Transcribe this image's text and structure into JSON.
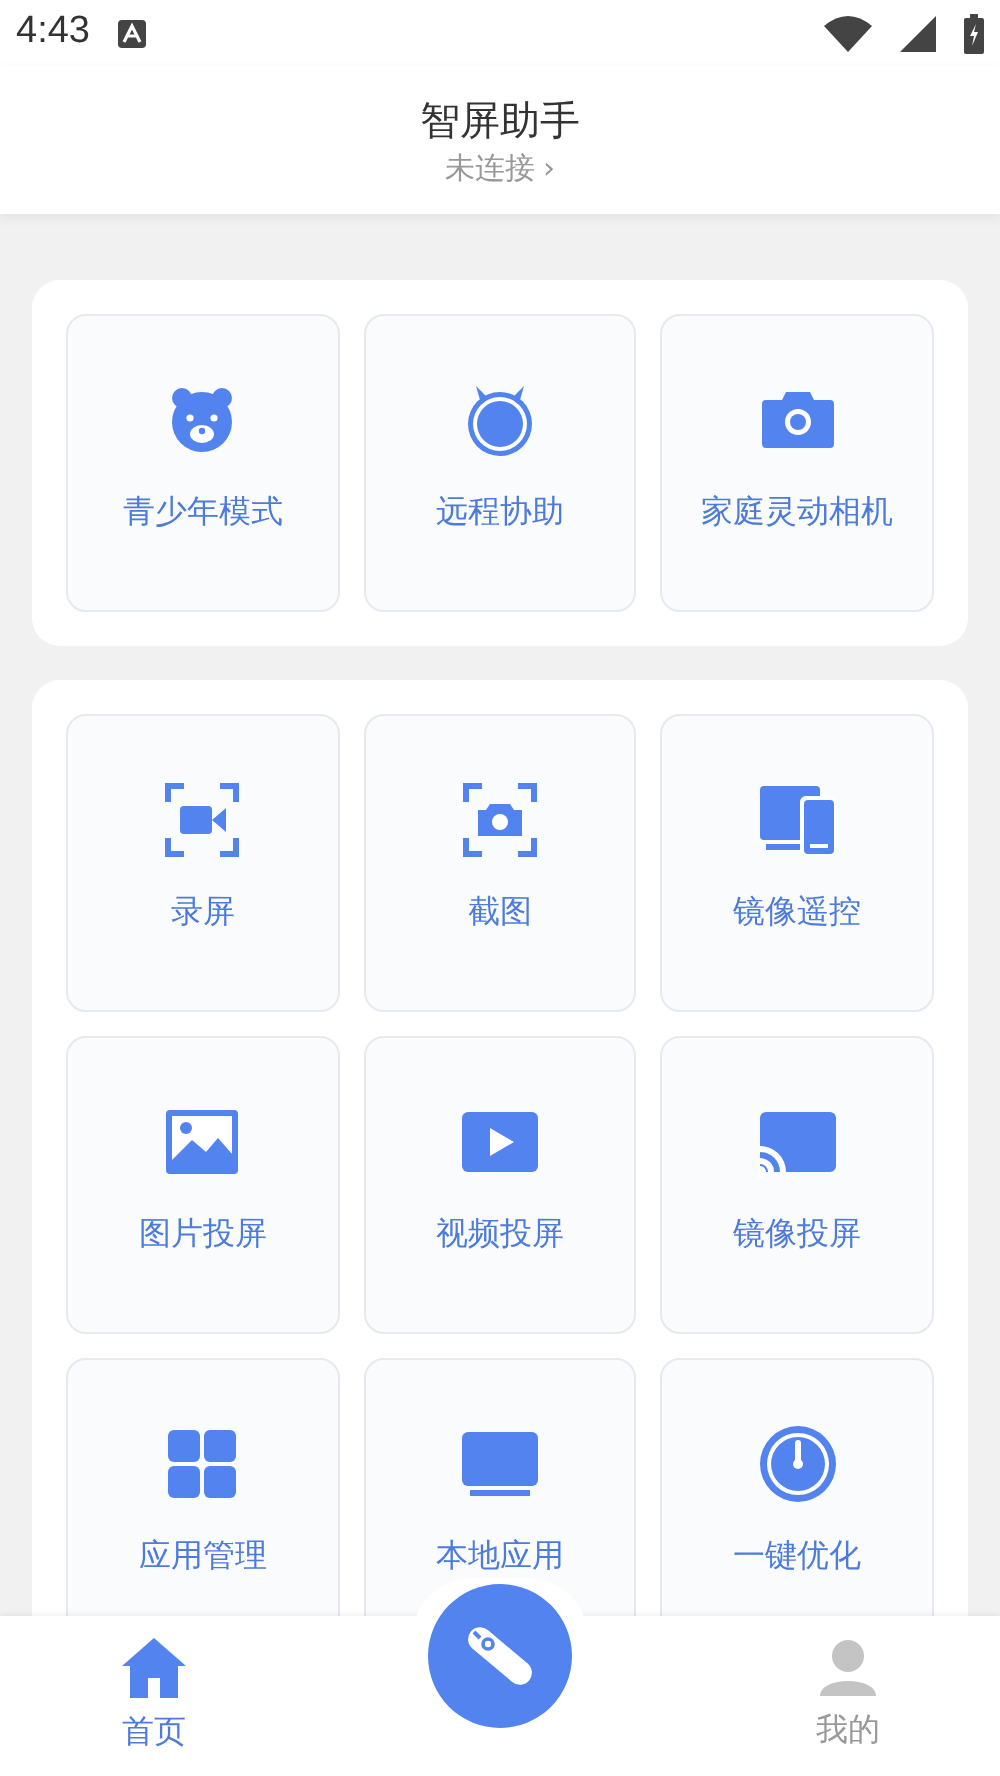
{
  "status_bar": {
    "time": "4:43"
  },
  "header": {
    "title": "智屏助手",
    "subtitle": "未连接",
    "chevron": "›"
  },
  "sections": [
    {
      "items": [
        {
          "label": "青少年模式",
          "kind": "bear"
        },
        {
          "label": "远程协助",
          "kind": "robot"
        },
        {
          "label": "家庭灵动相机",
          "kind": "camera"
        }
      ]
    },
    {
      "items": [
        {
          "label": "录屏",
          "kind": "record"
        },
        {
          "label": "截图",
          "kind": "screenshot"
        },
        {
          "label": "镜像遥控",
          "kind": "devices"
        },
        {
          "label": "图片投屏",
          "kind": "image"
        },
        {
          "label": "视频投屏",
          "kind": "video"
        },
        {
          "label": "镜像投屏",
          "kind": "cast"
        },
        {
          "label": "应用管理",
          "kind": "apps"
        },
        {
          "label": "本地应用",
          "kind": "monitor"
        },
        {
          "label": "一键优化",
          "kind": "gauge"
        }
      ]
    }
  ],
  "tabs": [
    {
      "label": "首页",
      "kind": "home",
      "selected": true
    },
    {
      "label": "我的",
      "kind": "person",
      "selected": false
    }
  ]
}
